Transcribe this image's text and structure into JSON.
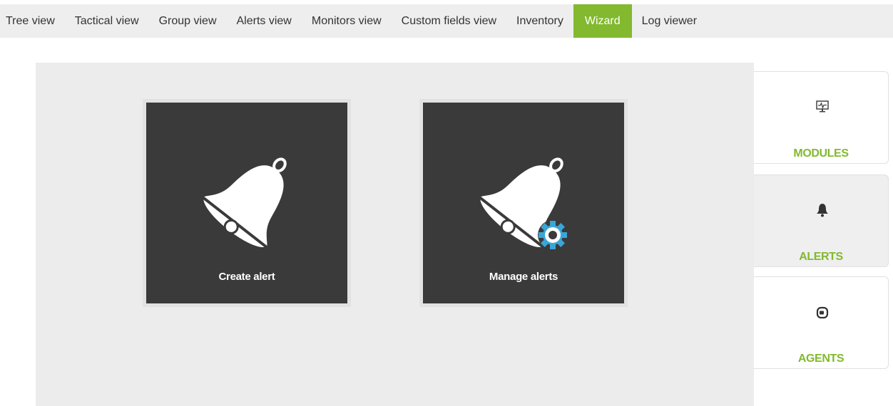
{
  "tabs": [
    {
      "label": "Tree view",
      "active": false
    },
    {
      "label": "Tactical view",
      "active": false
    },
    {
      "label": "Group view",
      "active": false
    },
    {
      "label": "Alerts view",
      "active": false
    },
    {
      "label": "Monitors view",
      "active": false
    },
    {
      "label": "Custom fields view",
      "active": false
    },
    {
      "label": "Inventory",
      "active": false
    },
    {
      "label": "Wizard",
      "active": true
    },
    {
      "label": "Log viewer",
      "active": false
    }
  ],
  "cards": {
    "create": {
      "label": "Create alert",
      "icon": "bell-icon"
    },
    "manage": {
      "label": "Manage alerts",
      "icon": "bell-gear-icon"
    }
  },
  "side_menu": {
    "modules": {
      "label": "MODULES",
      "icon": "monitor-icon"
    },
    "alerts": {
      "label": "ALERTS",
      "icon": "bell-icon",
      "selected": true
    },
    "agents": {
      "label": "AGENTS",
      "icon": "agent-icon"
    }
  },
  "colors": {
    "accent": "#82b92e",
    "card_bg": "#3a3a3a",
    "gear": "#3aa6d8"
  }
}
